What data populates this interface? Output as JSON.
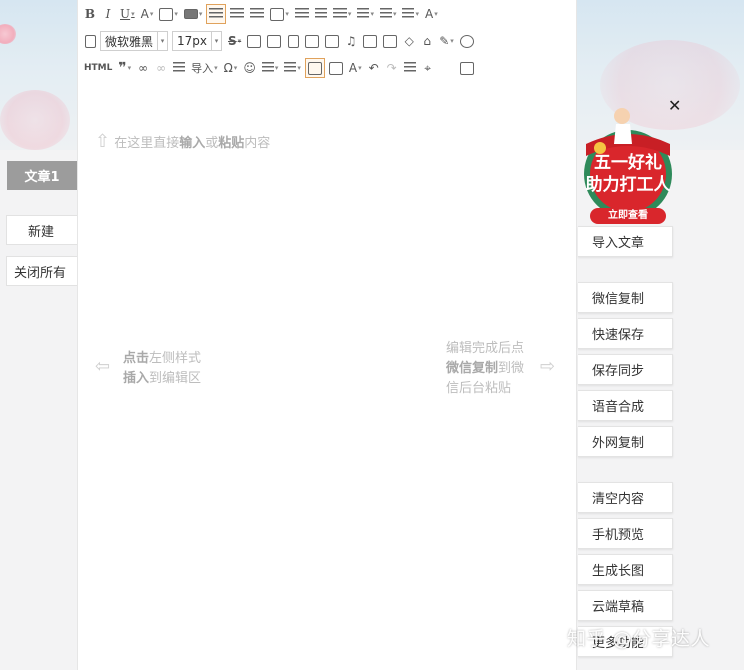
{
  "left_panel": {
    "active_tab": "文章1",
    "new_button": "新建",
    "close_all_button": "关闭所有"
  },
  "toolbar": {
    "font_family": "微软雅黑",
    "font_size": "17px",
    "html_label": "HTML",
    "insert_label": "导入"
  },
  "editor": {
    "hint_top": "在这里直接输入或粘贴内容",
    "hint_top_parts": {
      "a": "在这里直接",
      "b": "输入",
      "c": "或",
      "d": "粘贴",
      "e": "内容"
    },
    "hint_left": {
      "l1a": "点击",
      "l1b": "左侧样式",
      "l2a": "插入",
      "l2b": "到编辑区"
    },
    "hint_right": {
      "l1": "编辑完成后点",
      "l2a": "微信复制",
      "l2b": "到微",
      "l3": "信后台粘贴"
    }
  },
  "promo": {
    "line1": "五一好礼",
    "line2": "助力打工人",
    "cta": "立即查看"
  },
  "right_panel": {
    "buttons": [
      "导入文章",
      "微信复制",
      "快速保存",
      "保存同步",
      "语音合成",
      "外网复制",
      "清空内容",
      "手机预览",
      "生成长图",
      "云端草稿",
      "更多功能"
    ]
  },
  "watermark": "知乎 @分享达人",
  "colors": {
    "active_tab_bg": "#9c9c9c",
    "toolbar_active_border": "#e0a25c",
    "promo_red": "#d9262c",
    "promo_green": "#2f8a5a"
  }
}
